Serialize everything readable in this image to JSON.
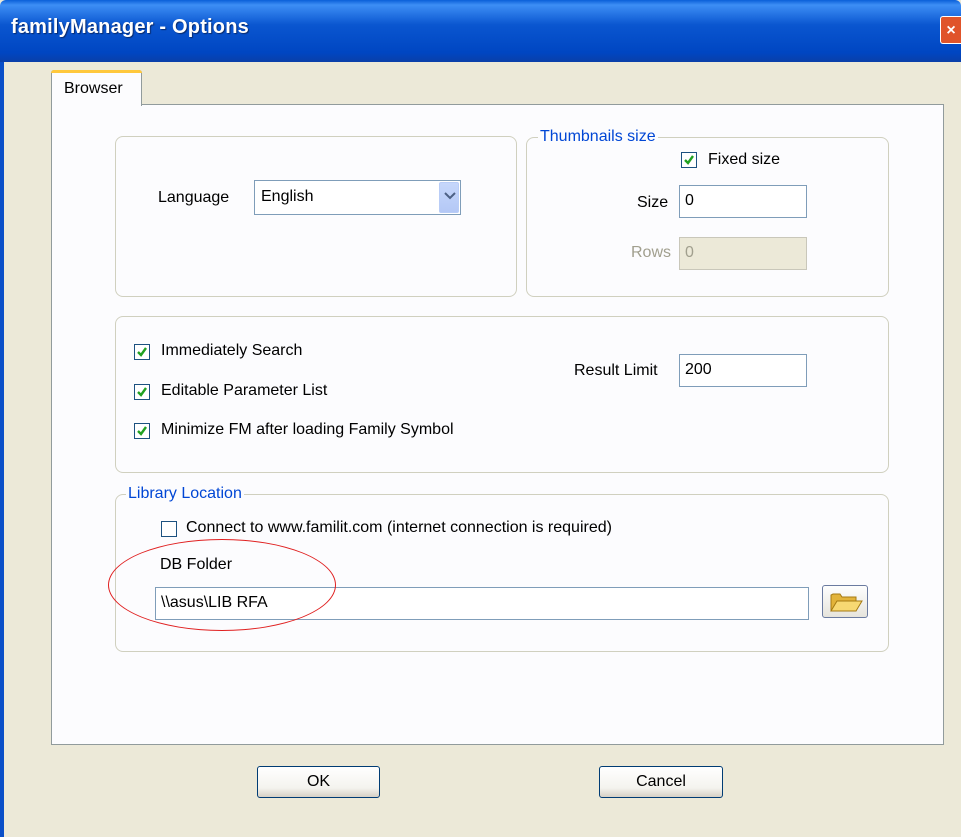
{
  "window": {
    "title": "familyManager - Options",
    "close_glyph": "×"
  },
  "tabs": [
    {
      "label": "Browser",
      "selected": true
    }
  ],
  "language": {
    "label": "Language",
    "value": "English"
  },
  "thumbnails": {
    "legend": "Thumbnails size",
    "fixed_size": {
      "label": "Fixed size",
      "checked": true
    },
    "size": {
      "label": "Size",
      "value": "0"
    },
    "rows": {
      "label": "Rows",
      "value": "0",
      "disabled": true
    }
  },
  "search_options": {
    "immediately_search": {
      "label": "Immediately Search",
      "checked": true
    },
    "editable_parameter_list": {
      "label": "Editable Parameter List",
      "checked": true
    },
    "minimize_fm": {
      "label": "Minimize FM after loading Family Symbol",
      "checked": true
    },
    "result_limit": {
      "label": "Result Limit",
      "value": "200"
    }
  },
  "library": {
    "legend": "Library Location",
    "connect": {
      "label": "Connect to www.familit.com  (internet connection is required)",
      "checked": false
    },
    "db_folder": {
      "label": "DB Folder",
      "value": "\\\\asus\\LIB RFA"
    },
    "browse_icon": "folder-open-icon"
  },
  "buttons": {
    "ok": "OK",
    "cancel": "Cancel"
  },
  "colors": {
    "title_bar": "#0a56d0",
    "legend_text": "#0046d5",
    "highlight_ellipse": "#e02020",
    "dialog_bg": "#ece9d8"
  }
}
